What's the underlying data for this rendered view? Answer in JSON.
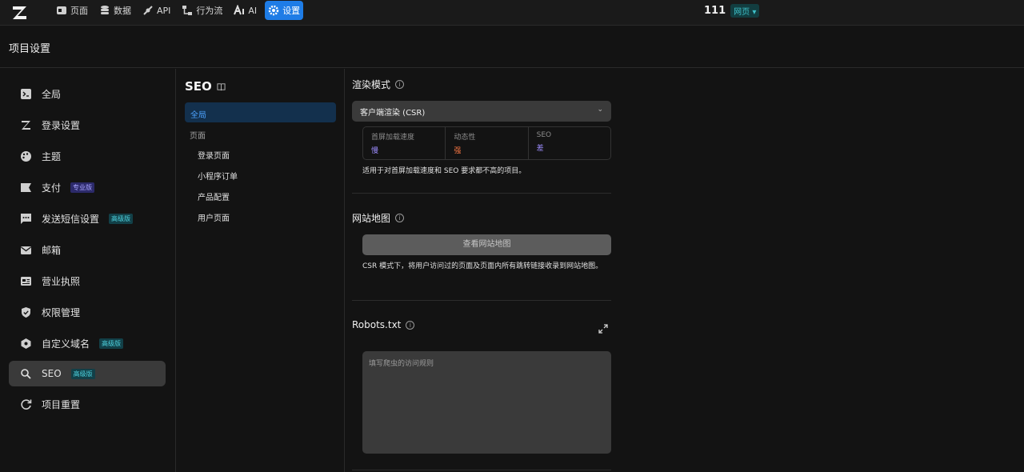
{
  "topbar": {
    "nav": [
      {
        "label": "页面",
        "icon": "page-icon"
      },
      {
        "label": "数据",
        "icon": "database-icon"
      },
      {
        "label": "API",
        "icon": "api-icon"
      },
      {
        "label": "行为流",
        "icon": "workflow-icon"
      },
      {
        "label": "AI",
        "icon": "ai-icon"
      },
      {
        "label": "设置",
        "icon": "gear-icon"
      }
    ],
    "project_name": "111",
    "project_badge": "网页 ▾"
  },
  "header": {
    "title": "项目设置"
  },
  "sidebar": {
    "items": [
      {
        "label": "全局",
        "icon": "terminal-icon"
      },
      {
        "label": "登录设置",
        "icon": "login-icon"
      },
      {
        "label": "主题",
        "icon": "palette-icon"
      },
      {
        "label": "支付",
        "icon": "payment-icon",
        "tag": "专业版"
      },
      {
        "label": "发送短信设置",
        "icon": "sms-icon",
        "tag": "高级版"
      },
      {
        "label": "邮箱",
        "icon": "mail-icon"
      },
      {
        "label": "营业执照",
        "icon": "license-icon"
      },
      {
        "label": "权限管理",
        "icon": "shield-icon"
      },
      {
        "label": "自定义域名",
        "icon": "domain-icon",
        "tag": "高级版"
      },
      {
        "label": "SEO",
        "icon": "search-icon",
        "tag": "高级版"
      },
      {
        "label": "项目重置",
        "icon": "reset-icon"
      }
    ]
  },
  "subnav": {
    "title": "SEO",
    "active": "全局",
    "group": "页面",
    "pages": [
      "登录页面",
      "小程序订单",
      "产品配置",
      "用户页面"
    ]
  },
  "render_mode": {
    "title": "渲染模式",
    "selected": "客户端渲染 (CSR)",
    "metrics": [
      {
        "key": "首屏加载速度",
        "value": "慢",
        "color": "#9d8cff"
      },
      {
        "key": "动态性",
        "value": "强",
        "color": "#ff7a45"
      },
      {
        "key": "SEO",
        "value": "差",
        "color": "#9d8cff"
      }
    ],
    "description": "适用于对首屏加载速度和 SEO 要求都不高的项目。"
  },
  "sitemap": {
    "title": "网站地图",
    "button": "查看网站地图",
    "description": "CSR 模式下，将用户访问过的页面及页面内所有跳转链接收录到网站地图。"
  },
  "robots": {
    "title": "Robots.txt",
    "placeholder": "填写爬虫的访问规则"
  }
}
